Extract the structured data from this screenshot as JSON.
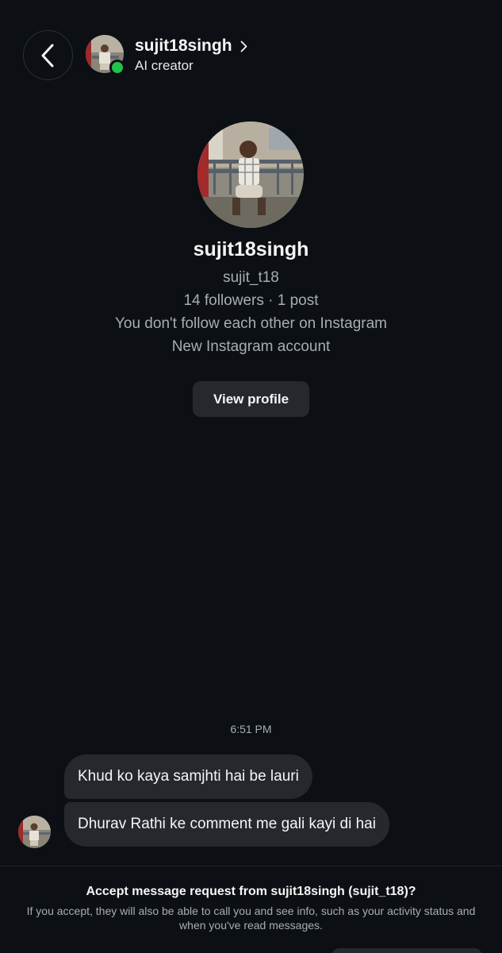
{
  "header": {
    "username": "sujit18singh",
    "subtitle": "AI creator",
    "status_color": "#22c34a"
  },
  "icons": {
    "back": "chevron-left-icon",
    "name_link": "chevron-right-icon"
  },
  "profile": {
    "name": "sujit18singh",
    "handle": "sujit_t18",
    "stats": "14 followers · 1 post",
    "follow_status": "You don't follow each other on Instagram",
    "account_note": "New Instagram account",
    "view_profile_label": "View profile"
  },
  "conversation": {
    "timestamp": "6:51 PM",
    "messages": [
      {
        "text": "Khud ko kaya samjhti hai be lauri"
      },
      {
        "text": "Dhurav Rathi ke comment me gali kayi di hai"
      }
    ]
  },
  "request": {
    "title": "Accept message request from sujit18singh (sujit_t18)?",
    "description": "If you accept, they will also be able to call you and see info, such as your activity status and when you've read messages."
  },
  "colors": {
    "background": "#0c1014",
    "bubble": "#25292e",
    "muted_text": "#a8adb3"
  }
}
